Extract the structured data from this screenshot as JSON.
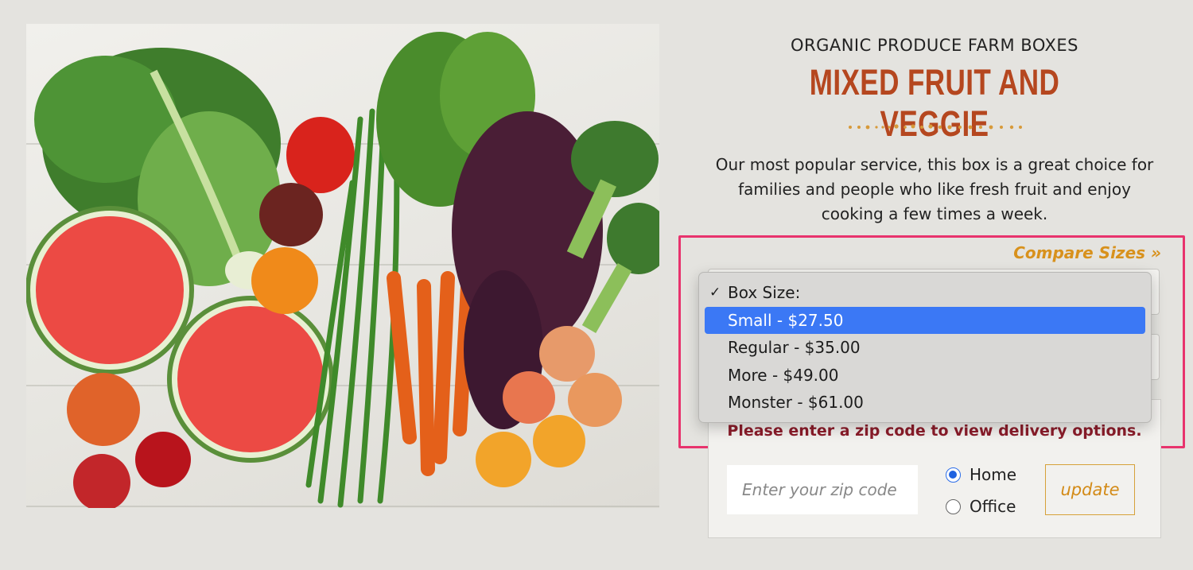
{
  "product": {
    "eyebrow": "ORGANIC PRODUCE FARM BOXES",
    "title": "MIXED FRUIT AND VEGGIE",
    "description": "Our most popular service, this box is a great choice for families and people who like fresh fruit and enjoy cooking a few times a week."
  },
  "compare_link": "Compare Sizes »",
  "box_size_menu": {
    "items": [
      {
        "label": "Box Size:",
        "checked": true,
        "highlighted": false
      },
      {
        "label": "Small - $27.50",
        "checked": false,
        "highlighted": true
      },
      {
        "label": "Regular - $35.00",
        "checked": false,
        "highlighted": false
      },
      {
        "label": "More - $49.00",
        "checked": false,
        "highlighted": false
      },
      {
        "label": "Monster - $61.00",
        "checked": false,
        "highlighted": false
      }
    ],
    "check_glyph": "✓"
  },
  "delivery": {
    "message": "Please enter a zip code to view delivery options.",
    "zip_placeholder": "Enter your zip code",
    "zip_value": "",
    "options": [
      {
        "label": "Home",
        "selected": true
      },
      {
        "label": "Office",
        "selected": false
      }
    ],
    "update_label": "update"
  },
  "colors": {
    "title": "#b5471f",
    "accent_link": "#d8911c",
    "highlight_border": "#e8336d",
    "menu_selection": "#3b78f5",
    "delivery_message": "#8b1c2a"
  }
}
